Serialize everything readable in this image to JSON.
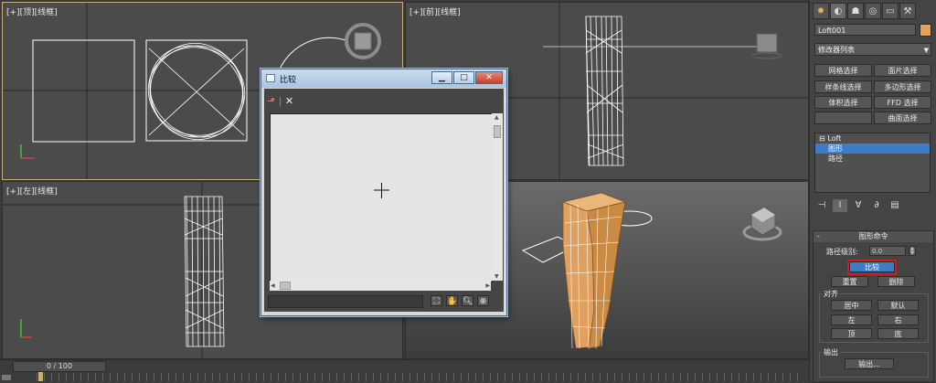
{
  "viewports": {
    "top": {
      "label": "[+][顶][线框]"
    },
    "front": {
      "label": "[+][前][线框]"
    },
    "left": {
      "label": "[+][左][线框]"
    },
    "perspective": {
      "label": ""
    }
  },
  "timeline": {
    "position": "0 / 100"
  },
  "command_panel": {
    "tabs": [
      {
        "icon": "create-icon",
        "glyph": "✸"
      },
      {
        "icon": "modify-icon",
        "glyph": "◐"
      },
      {
        "icon": "hierarchy-icon",
        "glyph": "☗"
      },
      {
        "icon": "motion-icon",
        "glyph": "◎"
      },
      {
        "icon": "display-icon",
        "glyph": "▭"
      },
      {
        "icon": "utilities-icon",
        "glyph": "⚒"
      }
    ],
    "object_name": "Loft001",
    "object_color": "#e8a056",
    "modifier_list": "修改器列表",
    "modifier_buttons": [
      "网格选择",
      "面片选择",
      "样条线选择",
      "多边形选择",
      "体积选择",
      "FFD 选择",
      "",
      "曲面选择"
    ],
    "stack": {
      "root": "Loft",
      "items": [
        "图形",
        "路径"
      ],
      "selected": "图形"
    },
    "shape_commands": {
      "title": "图形命令",
      "path_level_label": "路径级别:",
      "path_level_value": "0.0",
      "compare_button": "比较",
      "reset_button": "重置",
      "delete_button": "删除",
      "align_group": "对齐",
      "align_buttons": [
        "居中",
        "默认",
        "左",
        "右",
        "顶",
        "底"
      ],
      "output_group": "输出",
      "output_button": "输出..."
    }
  },
  "compare_dialog": {
    "title": "比较",
    "window_buttons": [
      "▁",
      "□",
      "✕"
    ]
  },
  "colors": {
    "accent_select": "#3e7cc8",
    "highlight_box": "#d11d1d",
    "active_viewport_border": "#c8b078",
    "loft_object": "#e0a060"
  }
}
